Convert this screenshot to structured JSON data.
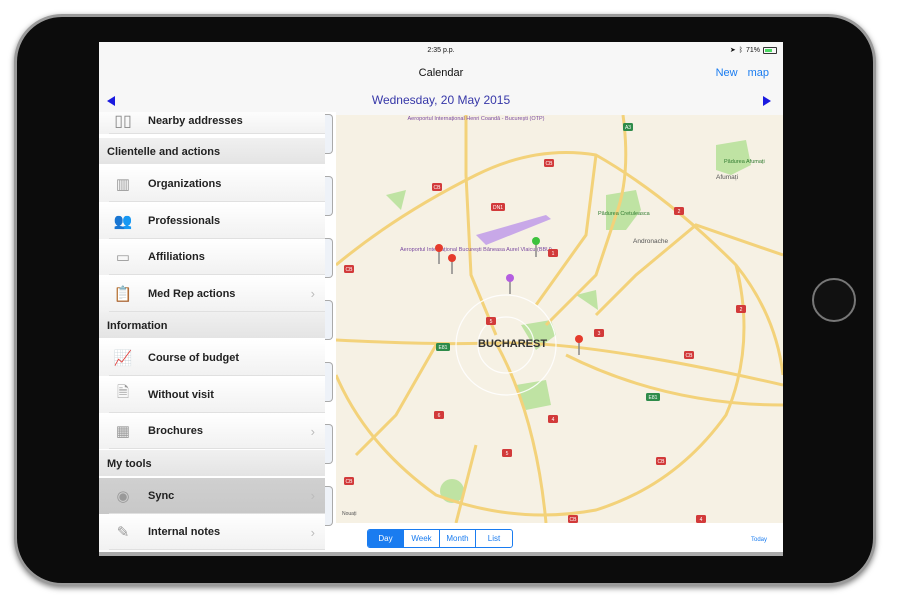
{
  "status": {
    "time": "2:35 p.p.",
    "battery": "71%",
    "battery_level": 0.71
  },
  "navbar": {
    "title": "Calendar",
    "new_label": "New",
    "map_label": "map"
  },
  "datebar": {
    "date": "Wednesday, 20 May 2015"
  },
  "sidebar": {
    "partial_item": "Nearby addresses",
    "sections": [
      {
        "title": "Clientelle and actions",
        "items": [
          {
            "label": "Organizations",
            "icon": "building-icon",
            "chevron": false
          },
          {
            "label": "Professionals",
            "icon": "people-icon",
            "chevron": false
          },
          {
            "label": "Affiliations",
            "icon": "id-card-icon",
            "chevron": false
          },
          {
            "label": "Med Rep actions",
            "icon": "clipboard-icon",
            "chevron": true
          }
        ]
      },
      {
        "title": "Information",
        "items": [
          {
            "label": "Course of budget",
            "icon": "chart-icon",
            "chevron": false
          },
          {
            "label": "Without visit",
            "icon": "document-search-icon",
            "chevron": false
          },
          {
            "label": "Brochures",
            "icon": "brochure-icon",
            "chevron": true
          }
        ]
      },
      {
        "title": "My tools",
        "items": [
          {
            "label": "Sync",
            "icon": "antenna-icon",
            "chevron": true,
            "selected": true
          },
          {
            "label": "Internal notes",
            "icon": "pencil-note-icon",
            "chevron": true
          }
        ]
      }
    ]
  },
  "map": {
    "city": "BUCHAREST",
    "labels": {
      "otp": "Aeroportul Internațional Henri Coandă - București (OTP)",
      "bbu": "Aeroportul Internațional București Băneasa Aurel Vlaicu (BBU)",
      "andronache": "Andronache",
      "afumati": "Afumați",
      "padurea_afumati": "Pădurea Afumați",
      "padurea_cretuleasca": "Pădurea Cretuleasca",
      "attribution": "Nouați"
    },
    "shields": [
      "A3",
      "DN1",
      "2",
      "CB",
      "E81",
      "5",
      "4",
      "3"
    ],
    "pin_colors": {
      "red": "#e53b2c",
      "green": "#3cc23c",
      "purple": "#b45ee0"
    }
  },
  "bottom": {
    "segments": [
      "Day",
      "Week",
      "Month",
      "List"
    ],
    "active": "Day",
    "today_label": "Today"
  },
  "colors": {
    "accent": "#1a7cf0",
    "date": "#3637a8"
  }
}
